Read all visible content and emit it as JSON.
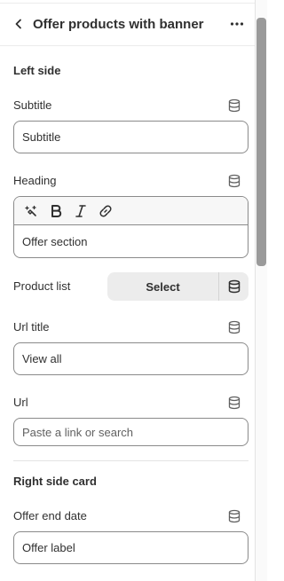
{
  "header": {
    "title": "Offer products with banner"
  },
  "left_side": {
    "title": "Left side",
    "subtitle": {
      "label": "Subtitle",
      "value": "Subtitle"
    },
    "heading": {
      "label": "Heading",
      "value": "Offer section"
    },
    "product_list": {
      "label": "Product list",
      "button": "Select"
    },
    "url_title": {
      "label": "Url title",
      "value": "View all"
    },
    "url": {
      "label": "Url",
      "placeholder": "Paste a link or search"
    }
  },
  "right_side_card": {
    "title": "Right side card",
    "offer_end_date": {
      "label": "Offer end date",
      "value": "Offer label"
    }
  },
  "icons": {
    "back": "chevron-left-icon",
    "more": "more-horizontal-icon",
    "dynamic_source": "database-icon",
    "rte": [
      "magic-icon",
      "bold-icon",
      "italic-icon",
      "link-icon"
    ]
  }
}
